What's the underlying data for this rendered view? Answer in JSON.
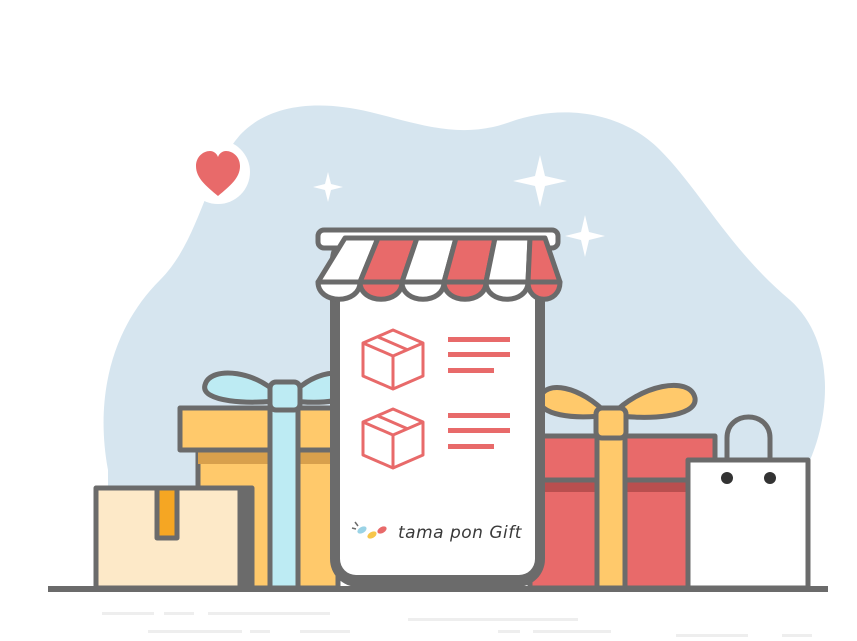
{
  "brand": {
    "name": "tama pon Gift"
  },
  "colors": {
    "blob": "#d6e5ef",
    "outline": "#6b6b6b",
    "red": "#e86a6a",
    "yellow": "#ffc96b",
    "cream": "#fde9c8",
    "light_blue": "#bdebf3",
    "orange_tape": "#f5a623",
    "white": "#ffffff",
    "shadow_line": "#eeeeee"
  },
  "icons": [
    "heart-icon",
    "sparkle-icon",
    "box-icon",
    "shopping-bag-icon",
    "gift-box-icon",
    "awning-icon"
  ]
}
